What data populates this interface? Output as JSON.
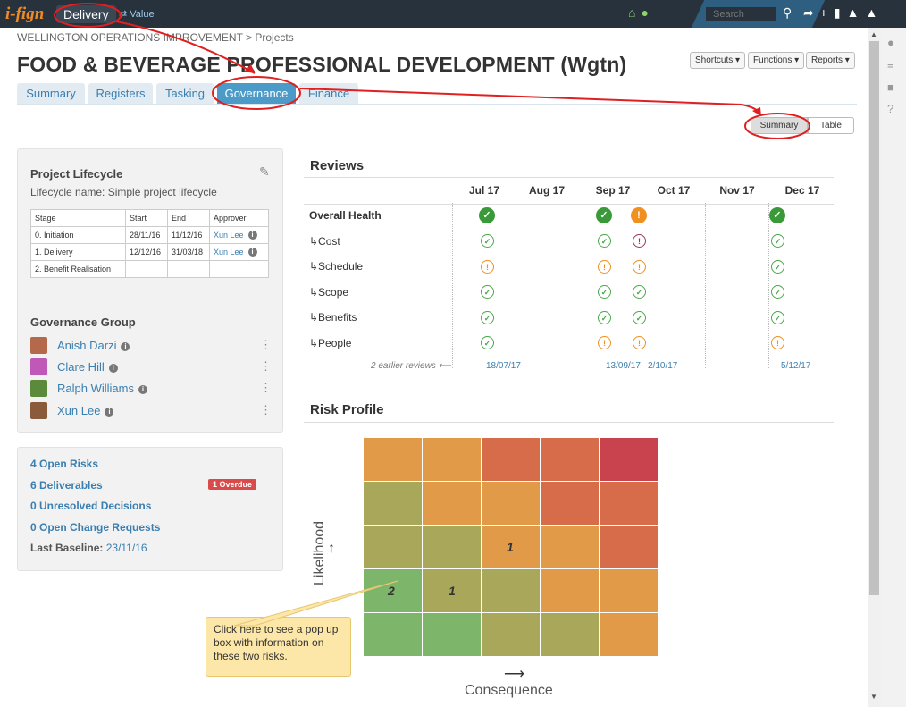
{
  "app": {
    "logo": "i-fign",
    "mode_tab": "Delivery",
    "value_link": "⇄ Value",
    "search_placeholder": "Search"
  },
  "breadcrumb": "WELLINGTON OPERATIONS IMPROVEMENT > Projects",
  "page_title": "FOOD & BEVERAGE PROFESSIONAL DEVELOPMENT (Wgtn)",
  "header_buttons": {
    "shortcuts": "Shortcuts ▾",
    "functions": "Functions ▾",
    "reports": "Reports ▾"
  },
  "tabs": [
    "Summary",
    "Registers",
    "Tasking",
    "Governance",
    "Finance"
  ],
  "view_toggle": {
    "summary": "Summary",
    "table": "Table"
  },
  "lifecycle": {
    "title": "Project Lifecycle",
    "name": "Lifecycle name: Simple project lifecycle",
    "headers": [
      "Stage",
      "Start",
      "End",
      "Approver"
    ],
    "rows": [
      {
        "stage": "0.  Initiation",
        "start": "28/11/16",
        "end": "11/12/16",
        "approver": "Xun Lee"
      },
      {
        "stage": "1.  Delivery",
        "start": "12/12/16",
        "end": "31/03/18",
        "approver": "Xun Lee"
      },
      {
        "stage": "2.  Benefit Realisation",
        "start": "",
        "end": "",
        "approver": ""
      }
    ]
  },
  "governance_group": {
    "title": "Governance Group",
    "members": [
      "Anish Darzi",
      "Clare Hill",
      "Ralph Williams",
      "Xun Lee"
    ]
  },
  "summary_links": {
    "open_risks": "4 Open Risks",
    "deliverables": "6 Deliverables",
    "overdue": "1 Overdue",
    "decisions": "0 Unresolved Decisions",
    "change_requests": "0 Open Change Requests",
    "baseline_label": "Last Baseline:",
    "baseline_date": "23/11/16"
  },
  "reviews": {
    "title": "Reviews",
    "months": [
      "Jul 17",
      "Aug 17",
      "Sep 17",
      "Oct 17",
      "Nov 17",
      "Dec 17"
    ],
    "rows": [
      "Overall Health",
      "↳Cost",
      "↳Schedule",
      "↳Scope",
      "↳Benefits",
      "↳People"
    ],
    "earlier": "2 earlier reviews ⟵",
    "dates": [
      "18/07/17",
      "13/09/17",
      "2/10/17",
      "5/12/17"
    ]
  },
  "risk_profile": {
    "title": "Risk Profile",
    "y_label": "Likelihood",
    "x_label": "Consequence",
    "cell_counts": {
      "r2c2": "1",
      "r3c0": "2",
      "r3c1": "1"
    }
  },
  "callout": "Click here to see a pop up box with information on these two risks."
}
